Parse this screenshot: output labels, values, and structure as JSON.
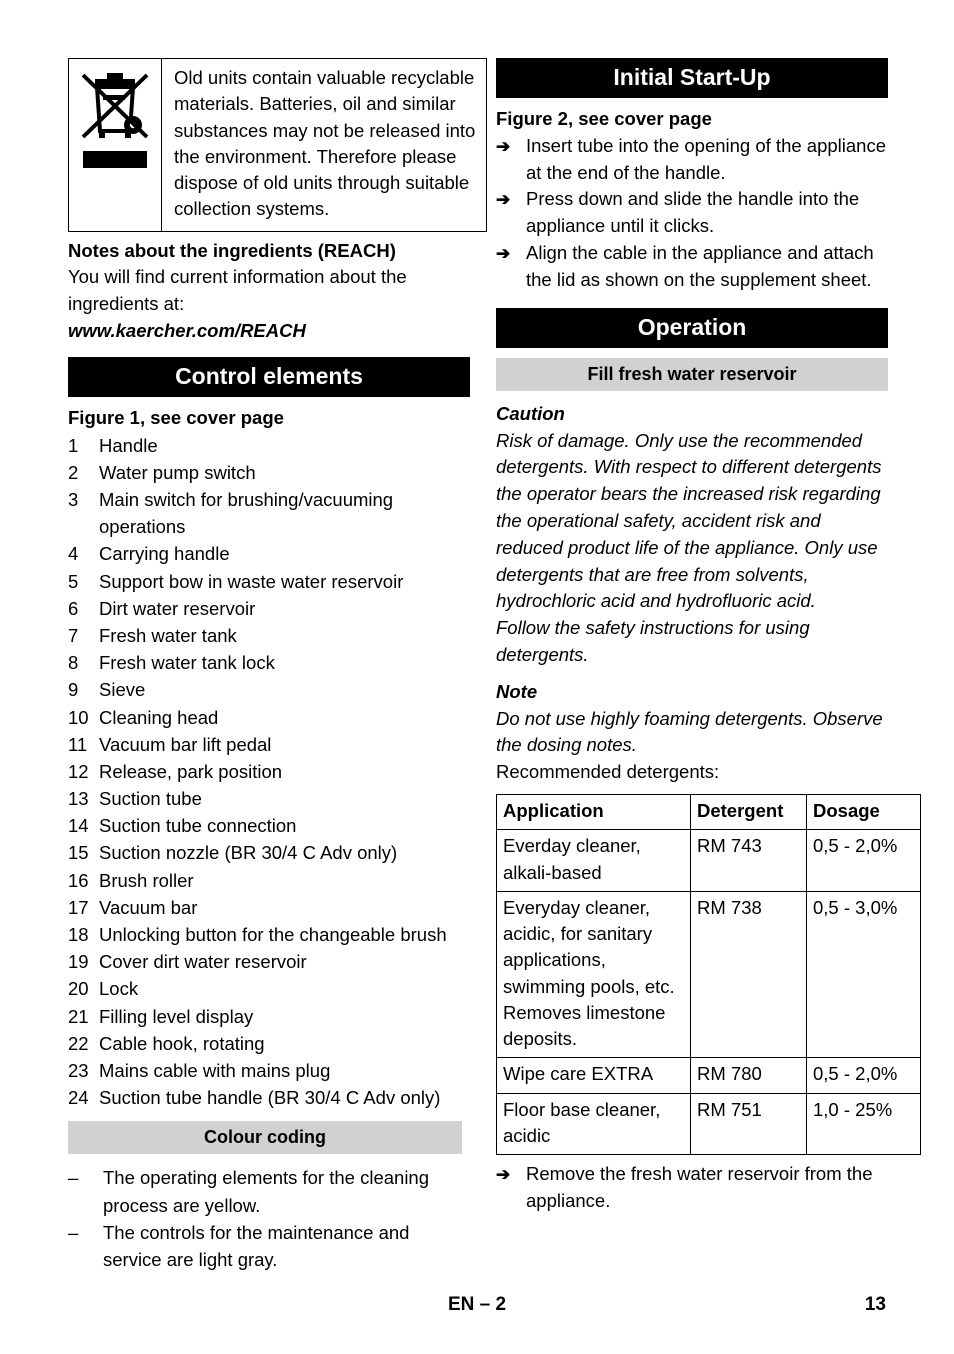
{
  "left_column": {
    "notice_box": {
      "icon": "weee-crossed-out-wheelie-bin",
      "text": "Old units contain valuable recyclable materials. Batteries, oil and similar substances may not be released into the environment. Therefore please dispose of old units through suitable collection systems."
    },
    "reach": {
      "heading": "Notes about the ingredients (REACH)",
      "body": "You will find current information about the ingredients at:",
      "url": "www.kaercher.com/REACH"
    },
    "control_elements": {
      "heading": "Control elements",
      "figure_note": "Figure 1, see cover page",
      "items": [
        {
          "num": "1",
          "label": "Handle"
        },
        {
          "num": "2",
          "label": "Water pump switch"
        },
        {
          "num": "3",
          "label": "Main switch for brushing/vacuuming operations"
        },
        {
          "num": "4",
          "label": "Carrying handle"
        },
        {
          "num": "5",
          "label": "Support bow in waste water reservoir"
        },
        {
          "num": "6",
          "label": "Dirt water reservoir"
        },
        {
          "num": "7",
          "label": "Fresh water tank"
        },
        {
          "num": "8",
          "label": "Fresh water tank lock"
        },
        {
          "num": "9",
          "label": "Sieve"
        },
        {
          "num": "10",
          "label": "Cleaning head"
        },
        {
          "num": "11",
          "label": "Vacuum bar lift pedal"
        },
        {
          "num": "12",
          "label": "Release, park position"
        },
        {
          "num": "13",
          "label": "Suction tube"
        },
        {
          "num": "14",
          "label": "Suction tube connection"
        },
        {
          "num": "15",
          "label": "Suction nozzle (BR 30/4 C Adv only)"
        },
        {
          "num": "16",
          "label": "Brush roller"
        },
        {
          "num": "17",
          "label": "Vacuum bar"
        },
        {
          "num": "18",
          "label": "Unlocking button for the changeable brush"
        },
        {
          "num": "19",
          "label": "Cover dirt water reservoir"
        },
        {
          "num": "20",
          "label": "Lock"
        },
        {
          "num": "21",
          "label": "Filling level display"
        },
        {
          "num": "22",
          "label": "Cable hook, rotating"
        },
        {
          "num": "23",
          "label": "Mains cable with mains plug"
        },
        {
          "num": "24",
          "label": "Suction tube handle (BR 30/4 C Adv only)"
        }
      ]
    },
    "colour_coding": {
      "heading": "Colour coding",
      "bullets": [
        {
          "marker": "–",
          "text": "The operating elements for the cleaning process are yellow."
        },
        {
          "marker": "–",
          "text": "The controls for the maintenance and service are light gray."
        }
      ]
    }
  },
  "right_column": {
    "initial_start_up": {
      "heading": "Initial Start-Up",
      "figure_note": "Figure 2, see cover page",
      "steps": [
        {
          "marker": "➔",
          "text": "Insert tube into the opening of the appliance at the end of the handle."
        },
        {
          "marker": "➔",
          "text": "Press down and slide the handle into the appliance until it clicks."
        },
        {
          "marker": "➔",
          "text": "Align the cable in the appliance and attach the lid as shown on the supplement sheet."
        }
      ]
    },
    "operation": {
      "heading": "Operation",
      "subheading": "Fill fresh water reservoir",
      "caution_label": "Caution",
      "caution_body_1": "Risk of damage. Only use the recommended detergents. With respect to different detergents the operator bears the increased risk regarding the operational safety, accident risk and reduced product life of the appliance. Only use detergents that are free from solvents, hydrochloric acid and hydrofluoric acid.",
      "caution_body_2": "Follow the safety instructions for using detergents.",
      "note_label": "Note",
      "note_body": "Do not use highly foaming detergents. Observe the dosing notes.",
      "recommended_label": "Recommended detergents:",
      "table": {
        "headers": [
          "Application",
          "Detergent",
          "Dosage"
        ],
        "rows": [
          {
            "application": "Everday cleaner, alkali-based",
            "detergent": "RM 743",
            "dosage": "0,5 - 2,0%"
          },
          {
            "application": "Everyday cleaner, acidic, for sanitary applications, swimming pools, etc. Removes limestone deposits.",
            "detergent": "RM 738",
            "dosage": "0,5 - 3,0%"
          },
          {
            "application": "Wipe care EXTRA",
            "detergent": "RM 780",
            "dosage": "0,5 - 2,0%"
          },
          {
            "application": "Floor base cleaner, acidic",
            "detergent": "RM 751",
            "dosage": "1,0 - 25%"
          }
        ]
      },
      "after_table_steps": [
        {
          "marker": "➔",
          "text": "Remove the fresh water reservoir from the appliance."
        }
      ]
    }
  },
  "footer": {
    "center": "EN – 2",
    "page_number": "13"
  },
  "colors": {
    "heading_bar": "#000000",
    "subheading_bar": "#d1d1d1",
    "text": "#000000",
    "page_background": "#ffffff"
  }
}
